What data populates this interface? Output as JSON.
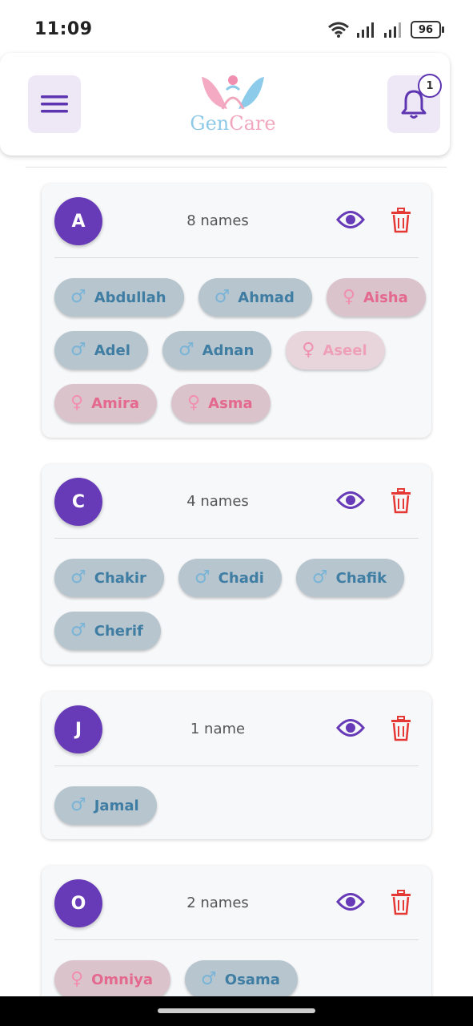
{
  "status": {
    "time": "11:09",
    "battery": "96"
  },
  "header": {
    "logo_gen": "Gen",
    "logo_care": "Care",
    "notification_count": "1"
  },
  "groups": [
    {
      "letter": "A",
      "count_label": "8 names",
      "names": [
        {
          "label": "Abdullah",
          "gender": "male"
        },
        {
          "label": "Ahmad",
          "gender": "male"
        },
        {
          "label": "Aisha",
          "gender": "female"
        },
        {
          "label": "Adel",
          "gender": "male"
        },
        {
          "label": "Adnan",
          "gender": "male"
        },
        {
          "label": "Aseel",
          "gender": "female"
        },
        {
          "label": "Amira",
          "gender": "female"
        },
        {
          "label": "Asma",
          "gender": "female"
        }
      ]
    },
    {
      "letter": "C",
      "count_label": "4 names",
      "names": [
        {
          "label": "Chakir",
          "gender": "male"
        },
        {
          "label": "Chadi",
          "gender": "male"
        },
        {
          "label": "Chafik",
          "gender": "male"
        },
        {
          "label": "Cherif",
          "gender": "male"
        }
      ]
    },
    {
      "letter": "J",
      "count_label": "1 name",
      "names": [
        {
          "label": "Jamal",
          "gender": "male"
        }
      ]
    },
    {
      "letter": "O",
      "count_label": "2 names",
      "names": [
        {
          "label": "Omniya",
          "gender": "female"
        },
        {
          "label": "Osama",
          "gender": "male"
        }
      ]
    }
  ],
  "colors": {
    "accent": "#673ab7",
    "delete": "#e53935",
    "male": "#3f7da3",
    "female": "#e4698f"
  }
}
